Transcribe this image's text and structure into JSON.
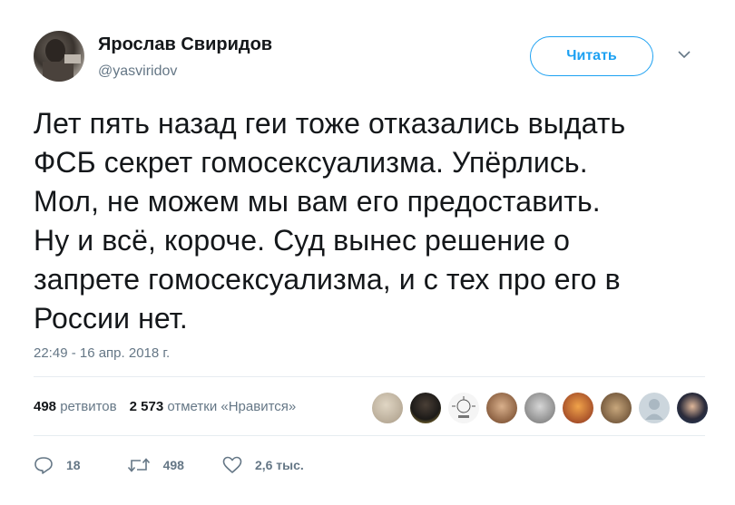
{
  "author": {
    "name": "Ярослав Свиридов",
    "handle": "@yasviridov"
  },
  "follow_button_label": "Читать",
  "tweet": {
    "lines": [
      "Лет пять назад геи тоже отказались выдать",
      "ФСБ секрет гомосексуализма. Упёрлись.",
      "Мол, не можем мы вам его предоставить.",
      "Ну и всё, короче. Суд вынес решение о",
      "запрете гомосексуализма, и с тех про его в",
      "России нет."
    ],
    "timestamp": "22:49 - 16 апр. 2018 г."
  },
  "stats": {
    "retweets_count": "498",
    "retweets_label": "ретвитов",
    "likes_count": "2 573",
    "likes_label": "отметки «Нравится»"
  },
  "likers": [
    {
      "icon": "liker-avatar-1",
      "color": "#c9bda8"
    },
    {
      "icon": "liker-avatar-2",
      "color": "#2d2a26"
    },
    {
      "icon": "liker-avatar-3",
      "color": "#f2f2f2"
    },
    {
      "icon": "liker-avatar-4",
      "color": "#8b5a3c"
    },
    {
      "icon": "liker-avatar-5",
      "color": "#9a9a9a"
    },
    {
      "icon": "liker-avatar-6",
      "color": "#a04a2a"
    },
    {
      "icon": "liker-avatar-7",
      "color": "#6b5238"
    },
    {
      "icon": "liker-avatar-8",
      "color": "#ccd6dd"
    },
    {
      "icon": "liker-avatar-9",
      "color": "#1d3557"
    }
  ],
  "actions": {
    "reply_count": "18",
    "retweet_count": "498",
    "like_count": "2,6 тыс."
  },
  "colors": {
    "accent": "#1da1f2",
    "text": "#14171a",
    "secondary": "#657786"
  }
}
